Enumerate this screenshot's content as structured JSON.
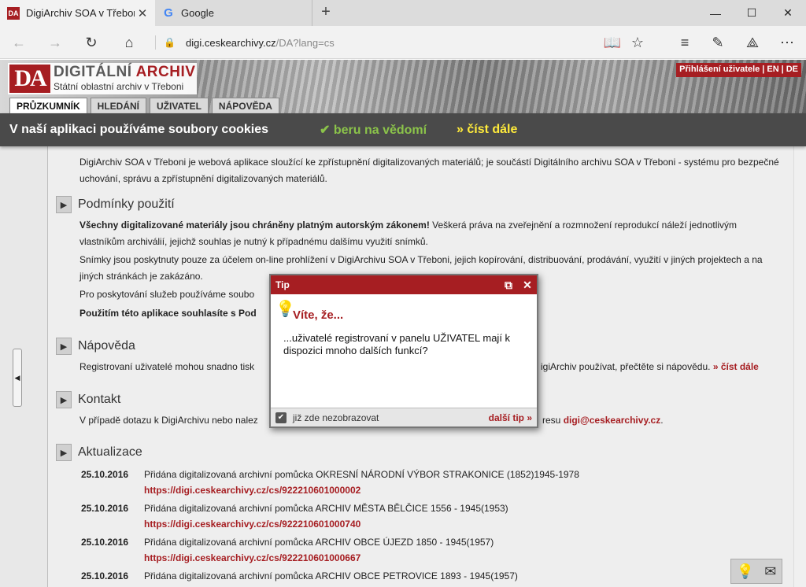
{
  "browser": {
    "tabs": [
      {
        "title": "DigiArchiv SOA v Třeboni",
        "favicon": "DA"
      },
      {
        "title": "Google",
        "favicon": "G"
      }
    ],
    "address": {
      "host": "digi.ceskearchivy.cz",
      "path": "/DA?lang=cs"
    }
  },
  "header": {
    "logo_mark": "DA",
    "logo_word_a": "DIGITÁLNÍ ",
    "logo_word_b": "ARCHIV",
    "logo_sub": "Státní oblastní archiv v Třeboni",
    "login": "Přihlášení uživatele",
    "sep1": "|",
    "lang_en": "EN",
    "sep2": "|",
    "lang_de": "DE",
    "tabs": [
      "PRŮZKUMNÍK",
      "HLEDÁNÍ",
      "UŽIVATEL",
      "NÁPOVĚDA"
    ]
  },
  "cookies": {
    "message": "V naší aplikaci používáme soubory cookies",
    "accept": "✔ beru na vědomí",
    "more": "» číst dále"
  },
  "content": {
    "intro": "DigiArchiv SOA v Třeboni je webová aplikace sloužící ke zpřístupnění digitalizovaných materiálů; je součástí Digitálního archivu SOA v Třeboni - systému pro bezpečné uchování, správu a zpřístupnění digitalizovaných materiálů.",
    "terms": {
      "title": "Podmínky použití",
      "p1_bold": "Všechny digitalizované materiály jsou chráněny platným autorským zákonem!",
      "p1_rest": " Veškerá práva na zveřejnění a rozmnožení reprodukcí náleží jednotlivým vlastníkům archiválií, jejichž souhlas je nutný k případnému dalšímu využití snímků.",
      "p2": "Snímky jsou poskytnuty pouze za účelem on-line prohlížení v DigiArchivu SOA v Třeboni, jejich kopírování, distribuování, prodávání, využití v jiných projektech a na jiných stránkách je zakázáno.",
      "p3": "Pro poskytování služeb používáme soubo",
      "p4": "Použitím této aplikace souhlasíte s Pod"
    },
    "help": {
      "title": "Nápověda",
      "text_a": "Registrovaní uživatelé mohou snadno tisk",
      "text_b": "igiArchiv používat, přečtěte si nápovědu.",
      "link": "» číst dále"
    },
    "contact": {
      "title": "Kontakt",
      "text_a": "V případě dotazu k DigiArchivu nebo nalez",
      "text_b": "resu ",
      "email": "digi@ceskearchivy.cz",
      "dot": "."
    },
    "updates": {
      "title": "Aktualizace",
      "items": [
        {
          "date": "25.10.2016",
          "desc": "Přidána digitalizovaná archivní pomůcka OKRESNÍ NÁRODNÍ VÝBOR STRAKONICE (1852)1945-1978",
          "link": "https://digi.ceskearchivy.cz/cs/922210601000002"
        },
        {
          "date": "25.10.2016",
          "desc": "Přidána digitalizovaná archivní pomůcka ARCHIV MĚSTA BĚLČICE 1556 - 1945(1953)",
          "link": "https://digi.ceskearchivy.cz/cs/922210601000740"
        },
        {
          "date": "25.10.2016",
          "desc": "Přidána digitalizovaná archivní pomůcka ARCHIV OBCE ÚJEZD 1850 - 1945(1957)",
          "link": "https://digi.ceskearchivy.cz/cs/922210601000667"
        },
        {
          "date": "25.10.2016",
          "desc": "Přidána digitalizovaná archivní pomůcka ARCHIV OBCE PETROVICE 1893 - 1945(1957)",
          "link": ""
        }
      ]
    }
  },
  "tip": {
    "title": "Tip",
    "heading": "Víte, že...",
    "text": "...uživatelé registrovaní v panelu UŽIVATEL mají k dispozici mnoho dalších funkcí?",
    "dont_show": "již zde nezobrazovat",
    "next": "další tip »"
  },
  "colors": {
    "brand": "#a61e22",
    "cookie_ok": "#8bc34a",
    "cookie_more": "#ffeb3b"
  }
}
